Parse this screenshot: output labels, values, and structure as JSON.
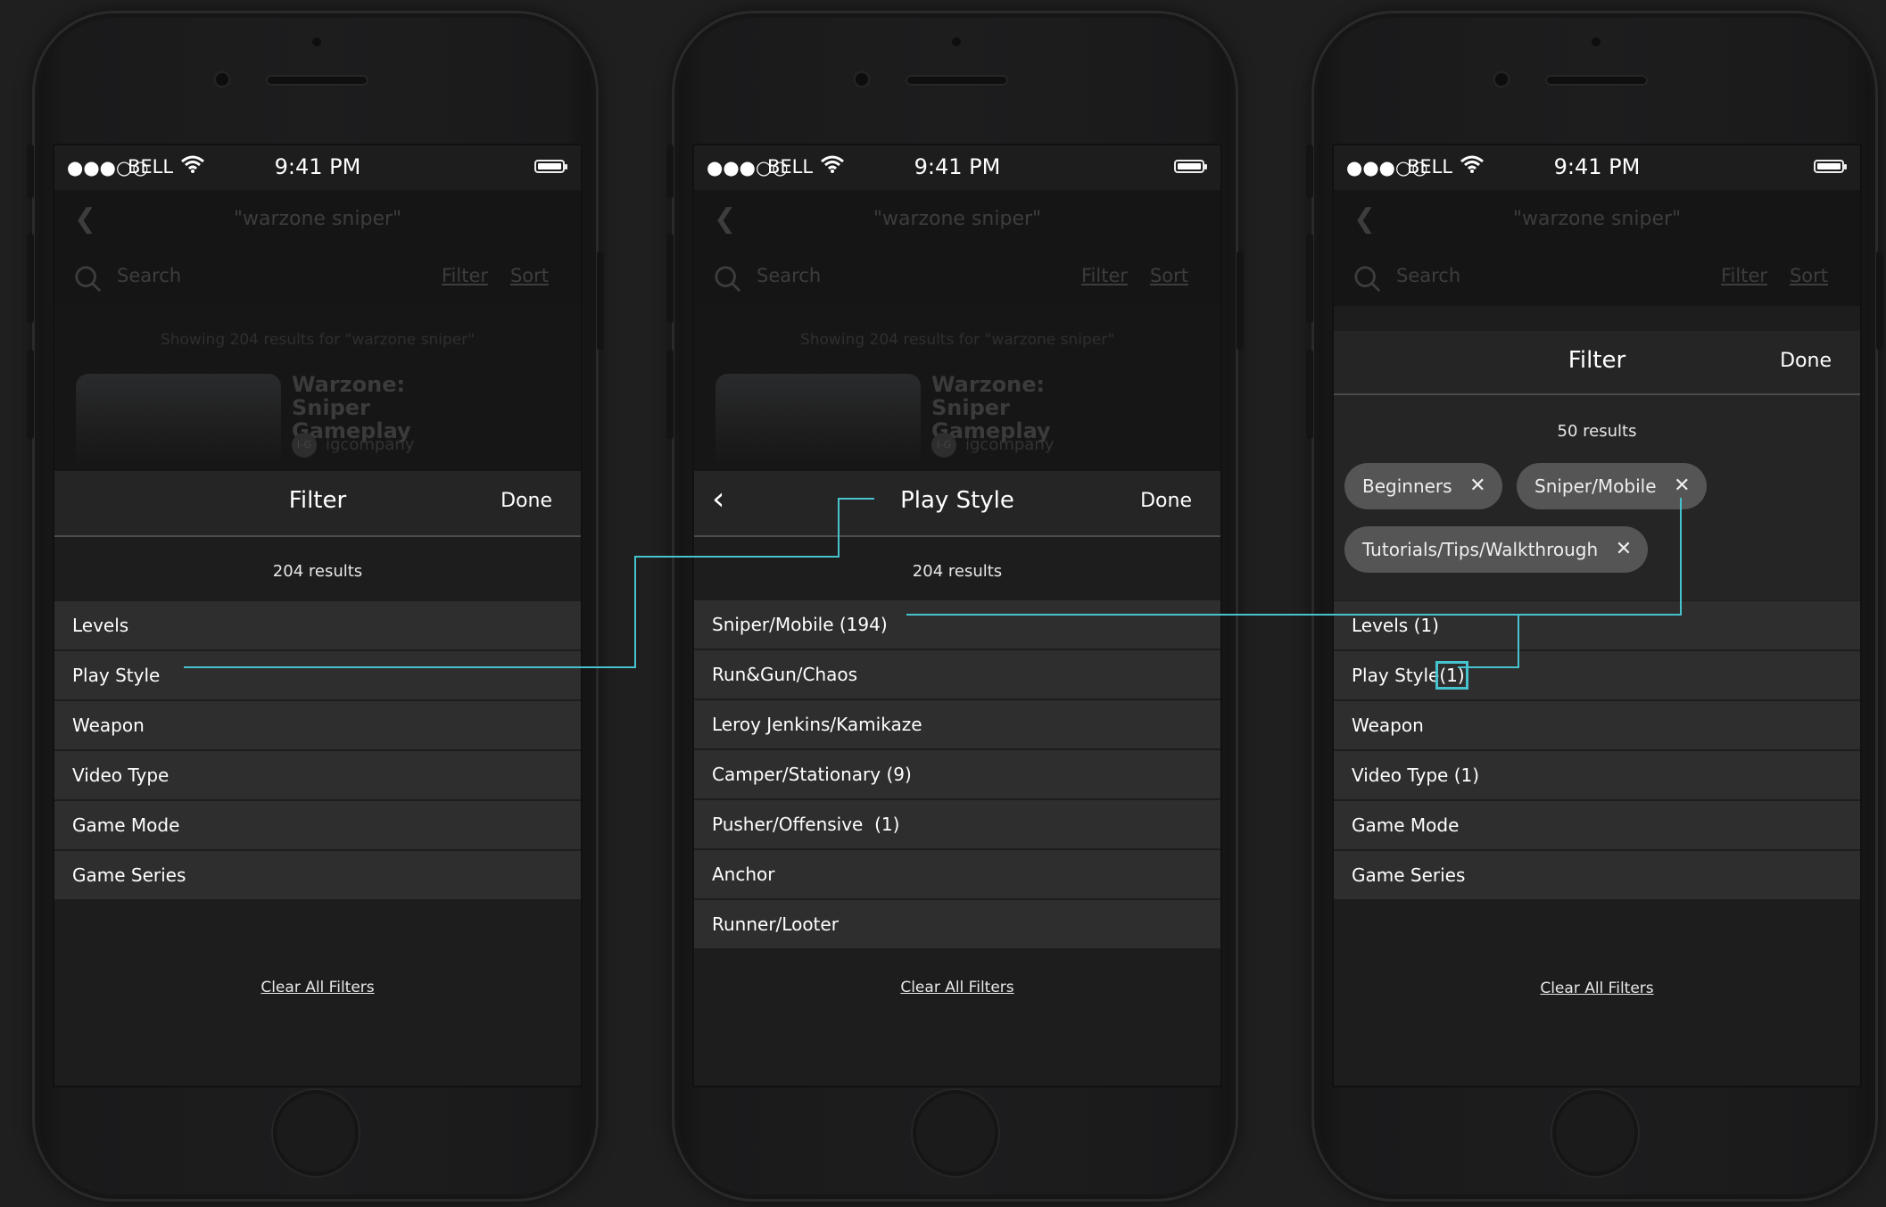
{
  "accent": "#46c3ce",
  "status": {
    "signal": "●●●○○",
    "carrier": "BELL",
    "time": "9:41 PM"
  },
  "nav": {
    "query": "\"warzone sniper\""
  },
  "searchbar": {
    "placeholder": "Search",
    "filter": "Filter",
    "sort": "Sort"
  },
  "results": {
    "showing": "Showing 204 results for \"warzone sniper\"",
    "video_title": "Warzone: Sniper Gameplay",
    "channel_avatar": "I-G",
    "channel": "igcompany"
  },
  "screen1": {
    "title": "Filter",
    "done": "Done",
    "count": "204 results",
    "items": [
      "Levels",
      "Play Style",
      "Weapon",
      "Video Type",
      "Game Mode",
      "Game Series"
    ],
    "clear": "Clear All Filters"
  },
  "screen2": {
    "title": "Play Style",
    "done": "Done",
    "count": "204 results",
    "items": [
      "Sniper/Mobile (194)",
      "Run&Gun/Chaos",
      "Leroy Jenkins/Kamikaze",
      "Camper/Stationary (9)",
      "Pusher/Offensive  (1)",
      "Anchor",
      "Runner/Looter"
    ],
    "clear": "Clear All Filters"
  },
  "screen3": {
    "title": "Filter",
    "done": "Done",
    "count": "50 results",
    "chips": [
      "Beginners",
      "Sniper/Mobile",
      "Tutorials/Tips/Walkthrough"
    ],
    "items": [
      "Levels (1)",
      "Play Style",
      "Weapon",
      "Video Type (1)",
      "Game Mode",
      "Game Series"
    ],
    "playstyle_count": "(1)",
    "clear": "Clear All Filters"
  }
}
